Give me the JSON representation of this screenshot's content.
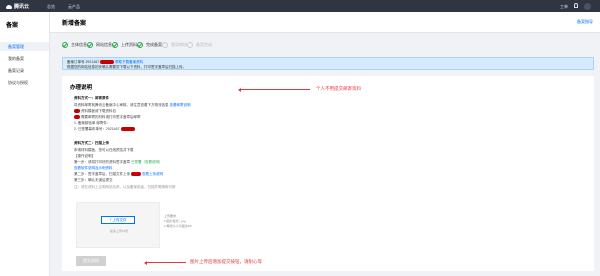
{
  "topbar": {
    "brand": "腾讯云",
    "nav": [
      "总览",
      "云产品"
    ],
    "right": [
      "工单"
    ]
  },
  "sidebar": {
    "title": "备案",
    "items": [
      "备案管理",
      "我的备案",
      "备案记录",
      "协议与授权"
    ],
    "active_index": 0
  },
  "header": {
    "title": "新增备案",
    "help": "备案指导"
  },
  "steps": [
    {
      "label": "主体信息",
      "state": "done"
    },
    {
      "label": "网站信息",
      "state": "done"
    },
    {
      "label": "上传资料",
      "state": "done"
    },
    {
      "label": "完成备案",
      "state": "done"
    },
    {
      "label": "管局审核",
      "state": "pending"
    },
    {
      "label": "备案完成",
      "state": "pending"
    }
  ],
  "notice": {
    "line1_prefix": "备案订单号 2921467",
    "line1_link": "帮助下载备案资料",
    "line2": "根据您的网站信息初步确认需要您下载以下资料，打印签字盖章后扫描上传。"
  },
  "content": {
    "heading": "办理说明",
    "method1_title": "资料方式一：邮寄原件",
    "method1_lines": [
      "将资料邮寄到腾讯云备案中心审核，请注意查看下方物流信息",
      "资料模板请下载资料包",
      "需要邮寄的材料请打印签字盖章后邮寄",
      "1. 备案核验单 邮寄件：",
      "2. 已签署幕布单号：2921467"
    ],
    "method1_link": "查看邮寄说明",
    "method2_title": "资料方式二：扫描上传",
    "method2_lines": [
      "申请材料模板，您可以在线预览并下载",
      "【操作说明】",
      "第一步：请将打印好的资料签字盖章",
      "查看软件说明及示例资料",
      "第二步：签字盖章后，扫描文件上传",
      "第三步：确认无误后提交"
    ],
    "method2_links": [
      "已签署（查看说明）",
      "查看上传说明"
    ],
    "method2_note": "注：请在资料上注明网站名称，以及备案用途，扫描件需清晰可辨",
    "upload_button": "+ 上传文件",
    "upload_hint": "最多上传10张",
    "side_hints": [
      "上传要求",
      "1.图片格式：jpg",
      "2.每张大小不超过2M"
    ],
    "submit": "提交资料"
  },
  "annotations": {
    "a1": "个人不用提交邮寄资料",
    "a2": "图片上传后增加提交按钮，请耐心等"
  },
  "colors": {
    "accent": "#006eff",
    "success": "#2ba94f",
    "annotation": "#e5373c",
    "topbar": "#2f3541"
  }
}
